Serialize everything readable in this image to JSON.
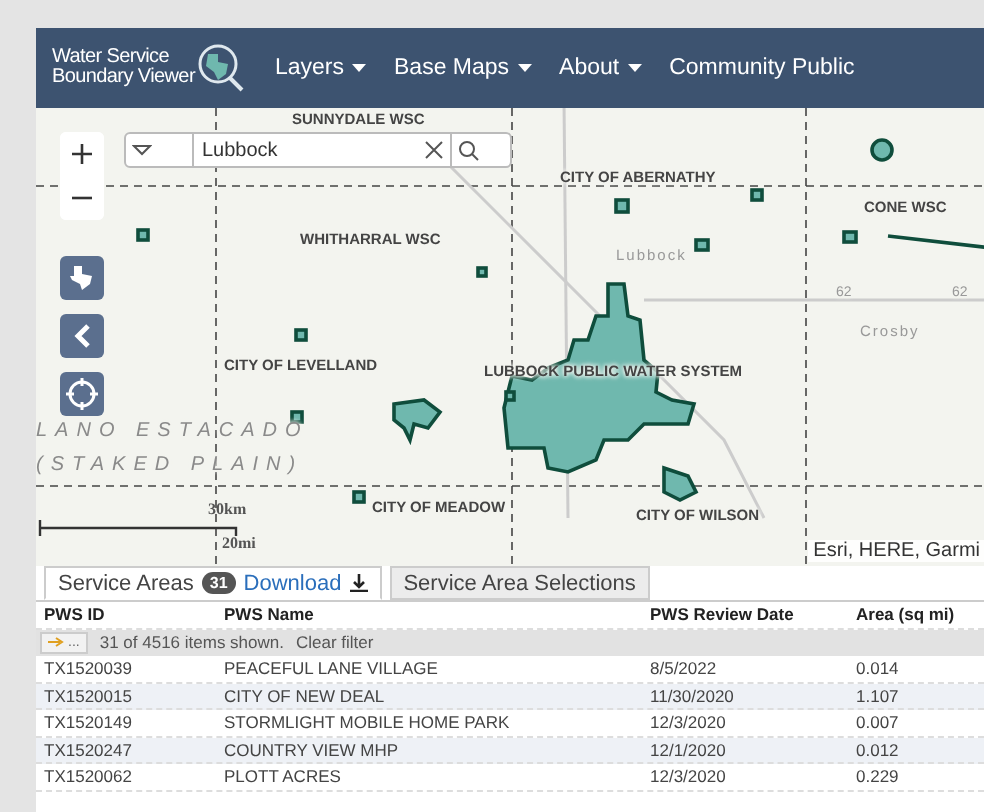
{
  "header": {
    "title_lines": [
      "Water Service",
      "Boundary Viewer"
    ],
    "nav": [
      {
        "label": "Layers",
        "dropdown": true
      },
      {
        "label": "Base Maps",
        "dropdown": true
      },
      {
        "label": "About",
        "dropdown": true
      },
      {
        "label": "Community Public",
        "dropdown": false
      }
    ]
  },
  "map": {
    "search": {
      "value": "Lubbock"
    },
    "labels": [
      {
        "text": "SUNNYDALE WSC",
        "kind": "area"
      },
      {
        "text": "WHITHARRAL WSC",
        "kind": "area"
      },
      {
        "text": "CITY OF ABERNATHY",
        "kind": "area"
      },
      {
        "text": "CONE WSC",
        "kind": "area"
      },
      {
        "text": "Lubbock",
        "kind": "place"
      },
      {
        "text": "62",
        "kind": "road"
      },
      {
        "text": "62",
        "kind": "road"
      },
      {
        "text": "Crosby",
        "kind": "place"
      },
      {
        "text": "CITY OF LEVELLAND",
        "kind": "area"
      },
      {
        "text": "LUBBOCK PUBLIC WATER SYSTEM",
        "kind": "area"
      },
      {
        "text": "LANO ESTACADO",
        "kind": "region"
      },
      {
        "text": "(STAKED PLAIN)",
        "kind": "region"
      },
      {
        "text": "CITY OF MEADOW",
        "kind": "area"
      },
      {
        "text": "CITY OF WILSON",
        "kind": "area"
      }
    ],
    "scale": {
      "km": "30km",
      "mi": "20mi"
    },
    "attribution": "Esri, HERE, Garmi"
  },
  "tabs": [
    {
      "label": "Service Areas",
      "selected": true,
      "count": "31",
      "link": "Download"
    },
    {
      "label": "Service Area Selections",
      "selected": false
    }
  ],
  "table": {
    "columns": [
      "PWS ID",
      "PWS Name",
      "PWS Review Date",
      "Area (sq mi)"
    ],
    "filter": {
      "button": "...",
      "status": "31 of 4516 items shown.",
      "clear": "Clear filter"
    },
    "rows": [
      [
        "TX1520039",
        "PEACEFUL LANE VILLAGE",
        "8/5/2022",
        "0.014"
      ],
      [
        "TX1520015",
        "CITY OF NEW DEAL",
        "11/30/2020",
        "1.107"
      ],
      [
        "TX1520149",
        "STORMLIGHT MOBILE HOME PARK",
        "12/3/2020",
        "0.007"
      ],
      [
        "TX1520247",
        "COUNTRY VIEW MHP",
        "12/1/2020",
        "0.012"
      ],
      [
        "TX1520062",
        "PLOTT ACRES",
        "12/3/2020",
        "0.229"
      ]
    ]
  }
}
